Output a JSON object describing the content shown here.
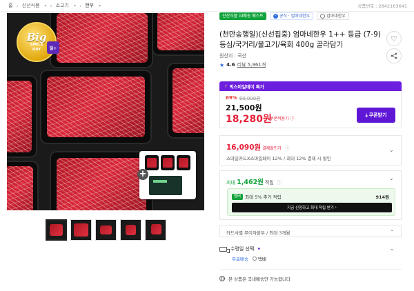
{
  "breadcrumb": {
    "items": [
      "홈",
      "신선식품",
      "소고기",
      "한우"
    ],
    "product_no": "상품번호 : 2842163641"
  },
  "main_image": {
    "badge": {
      "big": "Big",
      "line1": "SMILE",
      "line2": "DAY",
      "ribbon": "딜+"
    }
  },
  "thumbnails": {
    "count": 5
  },
  "tags": {
    "green": "신선식품 Gl배송 베스트",
    "certified": "공식 · 엄마네한우",
    "store": "엄마네한우"
  },
  "product": {
    "title": "(천만송행일)(신선집중) 엄마네한우 1++ 등급 (7-9) 등심/국거리/불고기/육회 400g 골라담기",
    "origin": "원산지 : 국산",
    "rating": "4.6",
    "reviews": "리뷰 5,961개"
  },
  "deal": {
    "header_label": "빅스마일데이 특가",
    "discount_pct": "69%",
    "original_price": "60,000원",
    "sale_price": "21,500원",
    "coupon_price": "18,280원",
    "coupon_label": "쿠폰적용가",
    "coupon_button": "쿠폰받기"
  },
  "card_discount": {
    "amount": "16,090원",
    "amount_label": "결제할인가",
    "description": "스마일카드X스마일페이 12% / 최대 12% 결제 시 할인"
  },
  "points": {
    "max_label": "최대",
    "max_amount": "1,462원",
    "suffix": "적립",
    "badge": "멤버",
    "extra": "최대 5% 추가 적립",
    "extra_points": "914원",
    "action": "지금 신청하고 최대 적립 받기"
  },
  "installment": {
    "text": "카드사별 무이자할부 / 최대 3개월"
  },
  "delivery": {
    "selector": "수령일 선택",
    "free": "무료배송",
    "option": "택배"
  },
  "notice": "본 상품은 국내배송만 가능합니다",
  "colors": {
    "accent_purple": "#5f17d6",
    "price_red": "#e6213a",
    "points_green": "#11a33b"
  }
}
